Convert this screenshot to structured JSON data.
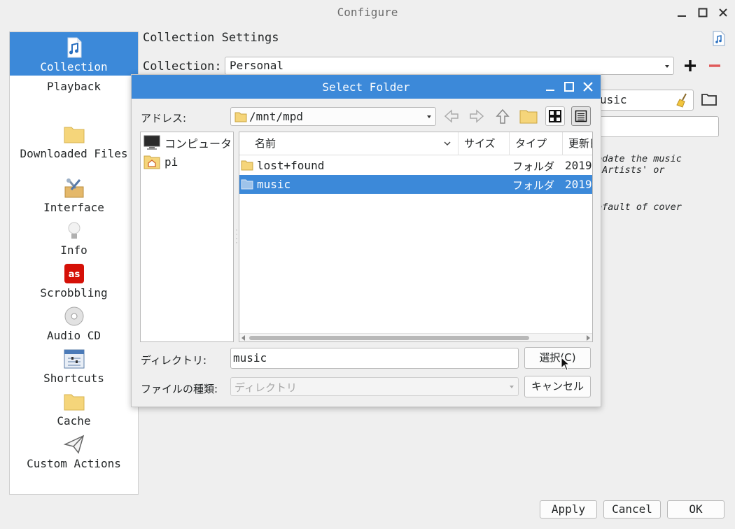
{
  "window": {
    "title": "Configure"
  },
  "sidebar": {
    "items": [
      {
        "label": "Collection",
        "icon": "music-file-icon",
        "active": true
      },
      {
        "label": "Playback",
        "icon": "",
        "active": false
      },
      {
        "label": "Downloaded Files",
        "icon": "folder-icon",
        "active": false
      },
      {
        "label": "Interface",
        "icon": "tools-icon",
        "active": false
      },
      {
        "label": "Info",
        "icon": "lightbulb-icon",
        "active": false
      },
      {
        "label": "Scrobbling",
        "icon": "lastfm-icon",
        "active": false
      },
      {
        "label": "Audio CD",
        "icon": "cd-icon",
        "active": false
      },
      {
        "label": "Shortcuts",
        "icon": "shortcuts-icon",
        "active": false
      },
      {
        "label": "Cache",
        "icon": "folder-icon",
        "active": false
      },
      {
        "label": "Custom Actions",
        "icon": "paper-plane-icon",
        "active": false
      }
    ]
  },
  "main": {
    "title": "Collection Settings",
    "collection_label": "Collection:",
    "collection_value": "Personal",
    "folder_value": "usic",
    "note1_line1": "odate the music",
    "note1_line2": "'Artists' or",
    "note2": "efault of cover"
  },
  "footer": {
    "apply": "Apply",
    "cancel": "Cancel",
    "ok": "OK"
  },
  "dialog": {
    "title": "Select Folder",
    "address_label": "アドレス:",
    "address_value": "/mnt/mpd",
    "places": [
      {
        "label": "コンピュータ",
        "icon": "computer-icon"
      },
      {
        "label": "pi",
        "icon": "home-folder-icon"
      }
    ],
    "columns": [
      "名前",
      "サイズ",
      "タイプ",
      "更新日"
    ],
    "files": [
      {
        "name": "lost+found",
        "type": "フォルダ",
        "date": "2019",
        "selected": false
      },
      {
        "name": "music",
        "type": "フォルダ",
        "date": "2019",
        "selected": true
      }
    ],
    "directory_label": "ディレクトリ:",
    "directory_value": "music",
    "filetype_label": "ファイルの種類:",
    "filetype_value": "ディレクトリ",
    "choose_button": "選択(C)",
    "cancel_button": "キャンセル"
  },
  "colors": {
    "accent": "#3c89d9",
    "minus": "#e05a5a",
    "lastfm": "#d51007"
  }
}
